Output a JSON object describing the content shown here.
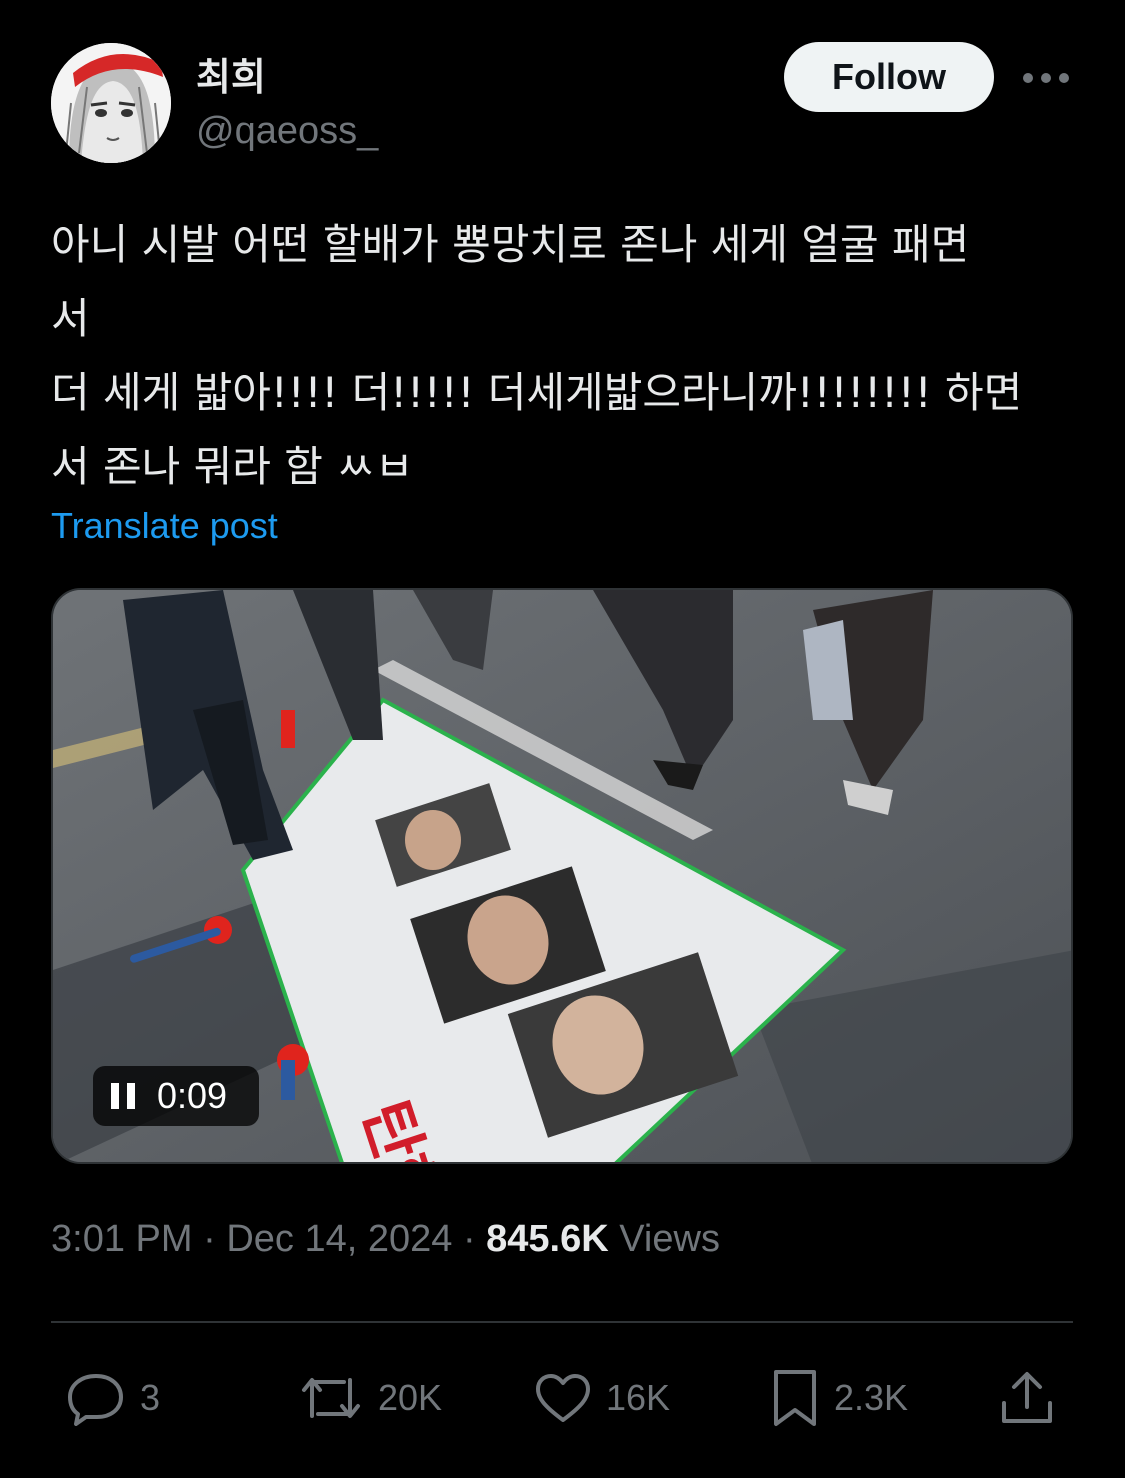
{
  "author": {
    "display_name": "최희",
    "handle": "@qaeoss_",
    "avatar_icon": "anime-avatar"
  },
  "follow_label": "Follow",
  "post": {
    "text": "아니 시발 어떤 할배가 뿅망치로 존나 세게 얼굴 패면\n서\n더 세게 밟아!!!! 더!!!!! 더세게밟으라니까!!!!!!!! 하면\n서 존나 뭐라 함 ㅆㅂ",
    "translate_label": "Translate post"
  },
  "media": {
    "type": "video",
    "time": "0:09",
    "control_icon": "pause-icon",
    "banner_text": "탄핵하라"
  },
  "meta": {
    "time": "3:01 PM",
    "date": "Dec 14, 2024",
    "views_count": "845.6K",
    "views_label": "Views",
    "separator": "·"
  },
  "actions": {
    "replies": "3",
    "reposts": "20K",
    "likes": "16K",
    "bookmarks": "2.3K"
  },
  "colors": {
    "background": "#000000",
    "text": "#e7e9ea",
    "muted": "#71767b",
    "link": "#1d9bf0",
    "follow_bg": "#eff3f4"
  }
}
